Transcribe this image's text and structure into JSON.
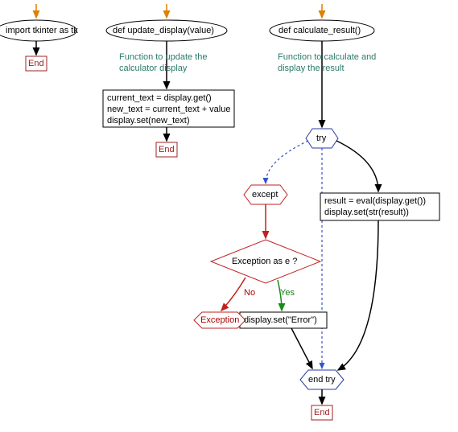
{
  "col1": {
    "import_stmt": "import tkinter as tk",
    "end": "End"
  },
  "col2": {
    "def_line": "def update_display(value)",
    "comment_l1": "Function to update the",
    "comment_l2": "calculator display",
    "body_l1": "current_text = display.get()",
    "body_l2": "new_text = current_text + value",
    "body_l3": "display.set(new_text)",
    "end": "End"
  },
  "col3": {
    "def_line": "def calculate_result()",
    "comment_l1": "Function to calculate and",
    "comment_l2": "display the result",
    "try": "try",
    "try_body_l1": "result = eval(display.get())",
    "try_body_l2": "display.set(str(result))",
    "except": "except",
    "diamond": "Exception as e ?",
    "yes": "Yes",
    "no": "No",
    "exception": "Exception",
    "except_body": "display.set(\"Error\")",
    "endtry": "end try",
    "end": "End"
  },
  "colors": {
    "arrow_orange": "#e08000",
    "arrow_black": "#000000",
    "arrow_blue": "#3355cc",
    "arrow_red": "#c02020",
    "arrow_green": "#1a8a1a",
    "hex_stroke": "#2a3aa0",
    "diamond_stroke": "#c02020",
    "end_stroke": "#a02020",
    "comment_color": "#2a7a6a"
  }
}
